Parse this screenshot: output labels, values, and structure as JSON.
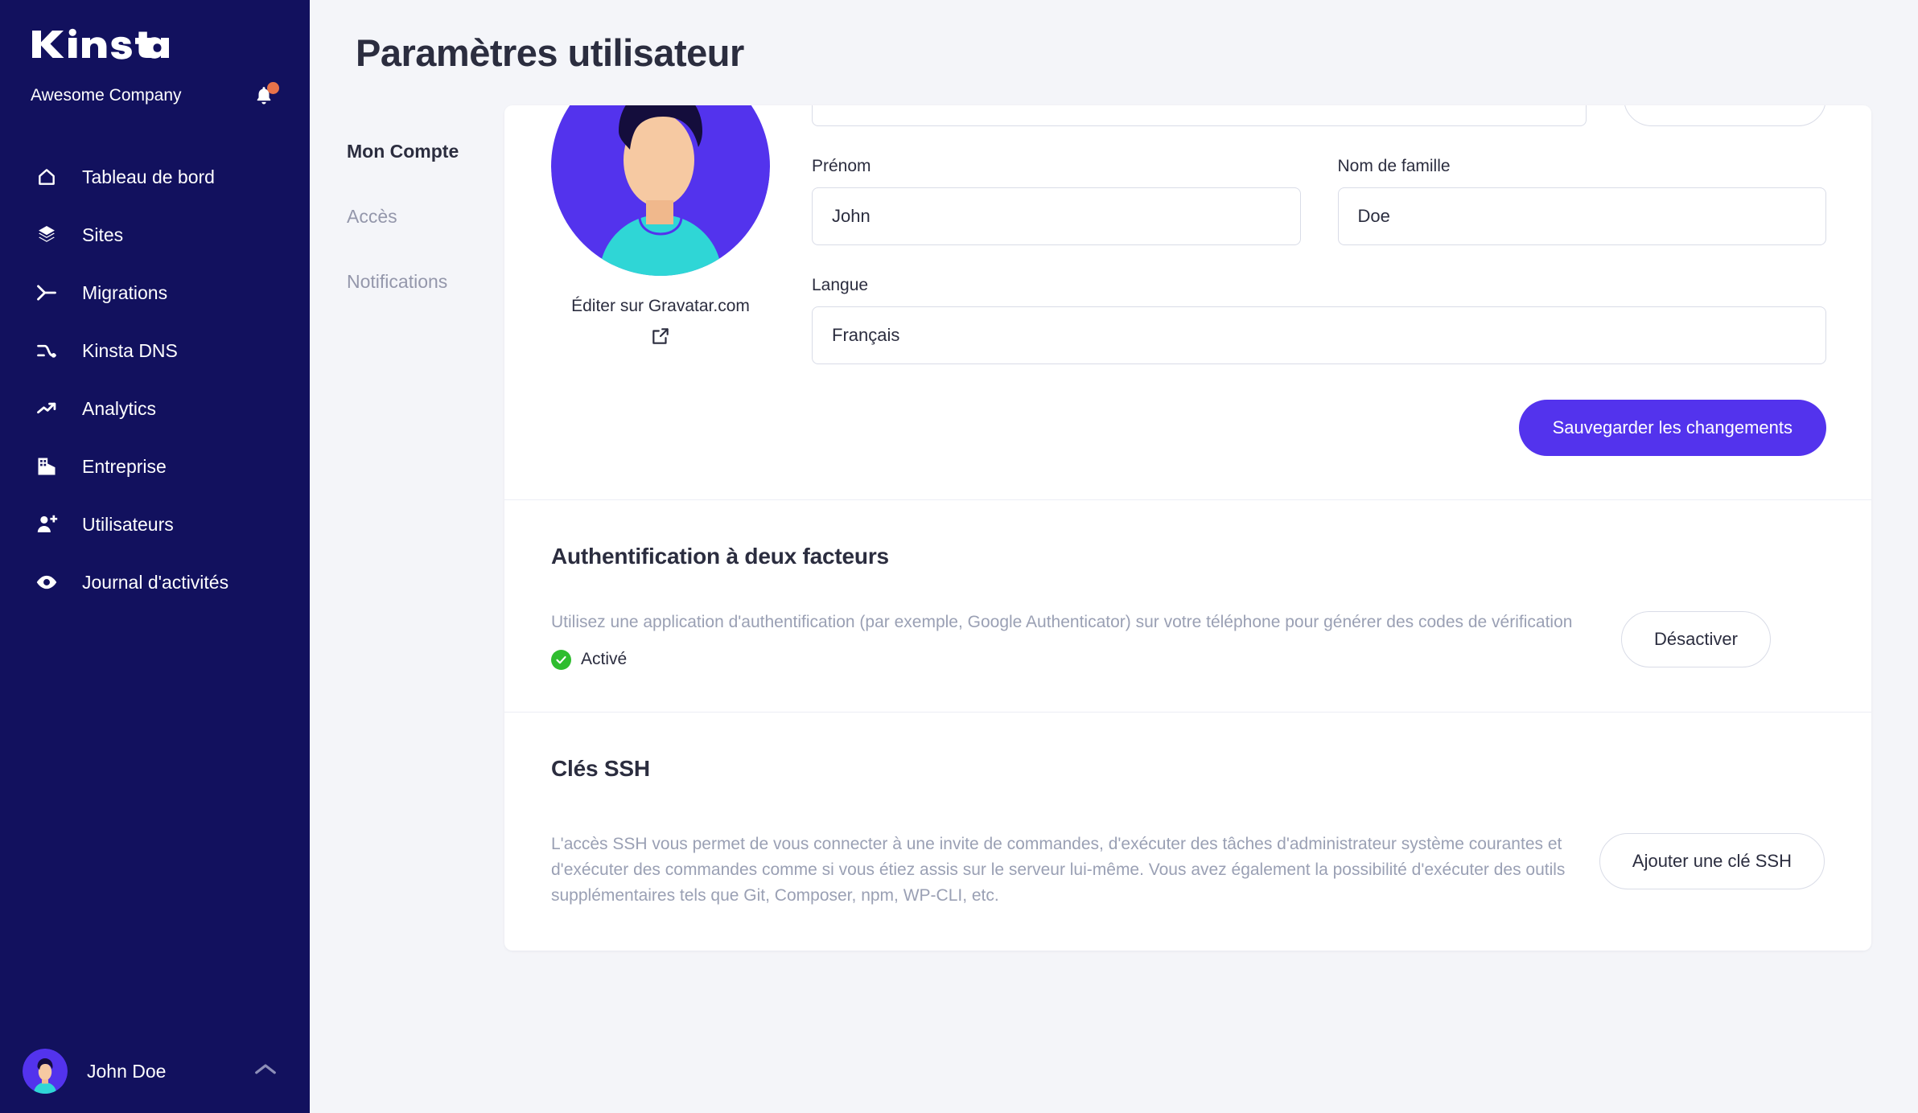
{
  "sidebar": {
    "brand": "Kinsta",
    "company": "Awesome Company",
    "bell_icon": "bell-icon",
    "items": [
      {
        "label": "Tableau de bord",
        "icon": "home-icon"
      },
      {
        "label": "Sites",
        "icon": "layers-icon"
      },
      {
        "label": "Migrations",
        "icon": "migrations-icon"
      },
      {
        "label": "Kinsta DNS",
        "icon": "dns-nodes-icon"
      },
      {
        "label": "Analytics",
        "icon": "trend-up-icon"
      },
      {
        "label": "Entreprise",
        "icon": "building-icon"
      },
      {
        "label": "Utilisateurs",
        "icon": "user-plus-icon"
      },
      {
        "label": "Journal d'activités",
        "icon": "eye-icon"
      }
    ],
    "user": {
      "name": "John Doe",
      "chevron": "chevron-up-icon"
    }
  },
  "header": {
    "title": "Paramètres utilisateur"
  },
  "subnav": {
    "items": [
      {
        "label": "Mon Compte",
        "active": true
      },
      {
        "label": "Accès",
        "active": false
      },
      {
        "label": "Notifications",
        "active": false
      }
    ]
  },
  "profile": {
    "gravatar_link": "Éditer sur Gravatar.com",
    "gravatar_icon": "external-link-icon",
    "fields": {
      "first_name": {
        "label": "Prénom",
        "value": "John",
        "placeholder": "Prénom"
      },
      "last_name": {
        "label": "Nom de famille",
        "value": "Doe",
        "placeholder": "Nom de famille"
      },
      "language": {
        "label": "Langue",
        "value": "Français",
        "placeholder": "Langue"
      }
    },
    "save_label": "Sauvegarder les changements"
  },
  "two_factor": {
    "title": "Authentification à deux facteurs",
    "description": "Utilisez une application d'authentification (par exemple, Google Authenticator) sur votre téléphone pour générer des codes de vérification",
    "status": "Activé",
    "status_icon": "check-circle-icon",
    "action_label": "Désactiver"
  },
  "ssh": {
    "title": "Clés SSH",
    "description": "L'accès SSH vous permet de vous connecter à une invite de commandes, d'exécuter des tâches d'administrateur système courantes et d'exécuter des commandes comme si vous étiez assis sur le serveur lui-même. Vous avez également la possibilité d'exécuter des outils supplémentaires tels que Git, Composer, npm, WP-CLI, etc.",
    "action_label": "Ajouter une clé SSH"
  },
  "annotation": {
    "icon": "down-arrow-annotation"
  },
  "colors": {
    "sidebar_bg": "#12115e",
    "primary": "#5333ed",
    "page_bg": "#f4f5f9",
    "text": "#2b2d3f",
    "muted": "#9aa0b4",
    "success": "#2fbd2f",
    "badge": "#e8734a",
    "annotation_arrow": "#5333ed"
  }
}
